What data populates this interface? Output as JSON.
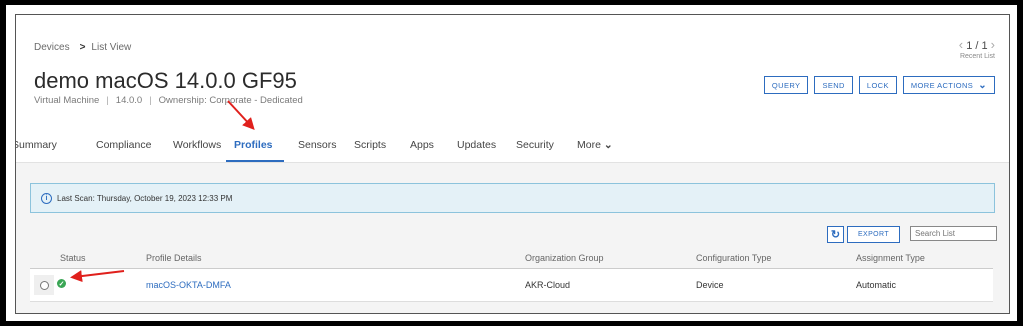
{
  "breadcrumb": {
    "root": "Devices",
    "current": "List View"
  },
  "pager": {
    "prev": "‹",
    "position": "1 / 1",
    "next": "›",
    "sub": "Recent List"
  },
  "device": {
    "title": "demo macOS 14.0.0 GF95",
    "type": "Virtual Machine",
    "version": "14.0.0",
    "ownership": "Ownership: Corporate - Dedicated"
  },
  "actions": {
    "query": "QUERY",
    "send": "SEND",
    "lock": "LOCK",
    "more": "MORE ACTIONS"
  },
  "tabs": {
    "summary": "Summary",
    "compliance": "Compliance",
    "workflows": "Workflows",
    "profiles": "Profiles",
    "sensors": "Sensors",
    "scripts": "Scripts",
    "apps": "Apps",
    "updates": "Updates",
    "security": "Security",
    "more": "More"
  },
  "scan": {
    "text": "Last Scan: Thursday, October 19, 2023 12:33 PM"
  },
  "toolbar": {
    "export": "EXPORT",
    "search_placeholder": "Search List"
  },
  "table": {
    "headers": [
      "Status",
      "Profile Details",
      "Organization Group",
      "Configuration Type",
      "Assignment Type"
    ],
    "rows": [
      {
        "status": "installed",
        "profile": "macOS-OKTA-DMFA",
        "org_group": "AKR-Cloud",
        "config_type": "Device",
        "assignment": "Automatic"
      }
    ]
  },
  "colors": {
    "accent": "#2d6cbf",
    "annotation_arrow": "#e0201c",
    "status_ok": "#3aa655"
  },
  "icons": {
    "breadcrumb_sep": "chevron-right-icon",
    "refresh": "refresh-icon",
    "info": "info-icon",
    "status": "check-circle-icon"
  }
}
